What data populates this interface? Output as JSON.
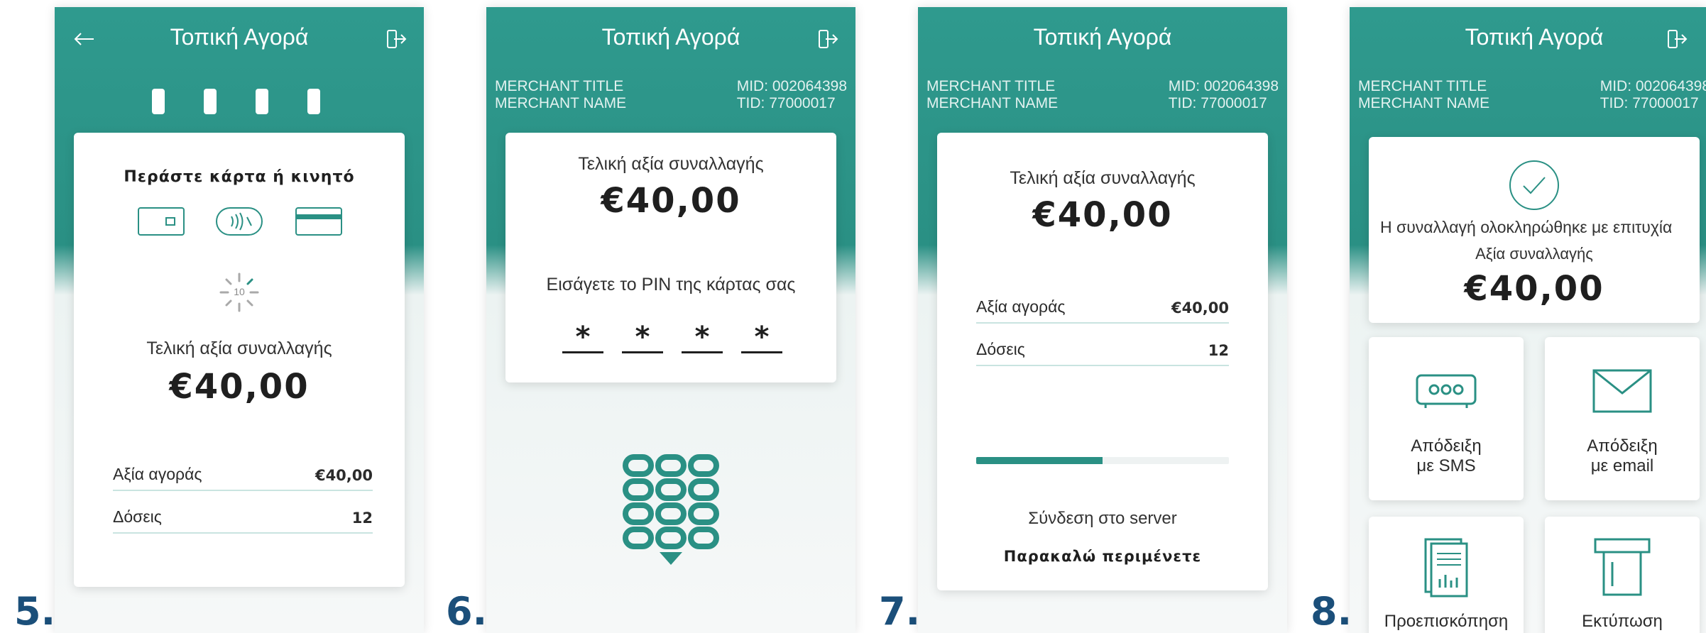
{
  "steps": [
    "5.",
    "6.",
    "7.",
    "8."
  ],
  "header": {
    "title": "Τοπική Αγορά"
  },
  "merchant": {
    "title": "MERCHANT TITLE",
    "name": "MERCHANT NAME",
    "mid": "MID: 002064398",
    "tid": "TID: 77000017"
  },
  "screen5": {
    "prompt": "Περάστε κάρτα ή κινητό",
    "timer": "10",
    "final_label": "Τελική αξία συναλλαγής",
    "amount": "€40,00",
    "rows": [
      {
        "label": "Αξία αγοράς",
        "value": "€40,00"
      },
      {
        "label": "Δόσεις",
        "value": "12"
      }
    ]
  },
  "screen6": {
    "final_label": "Τελική αξία συναλλαγής",
    "amount": "€40,00",
    "pin_prompt": "Εισάγετε το PIN της κάρτας σας",
    "pin_mask": [
      "*",
      "*",
      "*",
      "*"
    ]
  },
  "screen7": {
    "final_label": "Τελική αξία συναλλαγής",
    "amount": "€40,00",
    "rows": [
      {
        "label": "Αξία αγοράς",
        "value": "€40,00"
      },
      {
        "label": "Δόσεις",
        "value": "12"
      }
    ],
    "progress": 0.5,
    "status": "Σύνδεση στο server",
    "wait": "Παρακαλώ περιμένετε"
  },
  "screen8": {
    "success": "Η συναλλαγή ολοκληρώθηκε με επιτυχία",
    "amount_label": "Αξία συναλλαγής",
    "amount": "€40,00",
    "sms_line1": "Απόδειξη",
    "sms_line2": "με SMS",
    "email_line1": "Απόδειξη",
    "email_line2": "με email",
    "preview": "Προεπισκόπηση",
    "print": "Εκτύπωση"
  },
  "colors": {
    "teal": "#2a9084",
    "accent": "#2f9a8e",
    "step_number": "#1b4f7a"
  },
  "icons": [
    "back-arrow-icon",
    "exit-icon",
    "chip-card-icon",
    "contactless-icon",
    "swipe-card-icon",
    "spinner-icon",
    "keypad-icon",
    "success-check-icon",
    "sms-icon",
    "email-icon",
    "receipt-preview-icon",
    "printer-icon"
  ]
}
